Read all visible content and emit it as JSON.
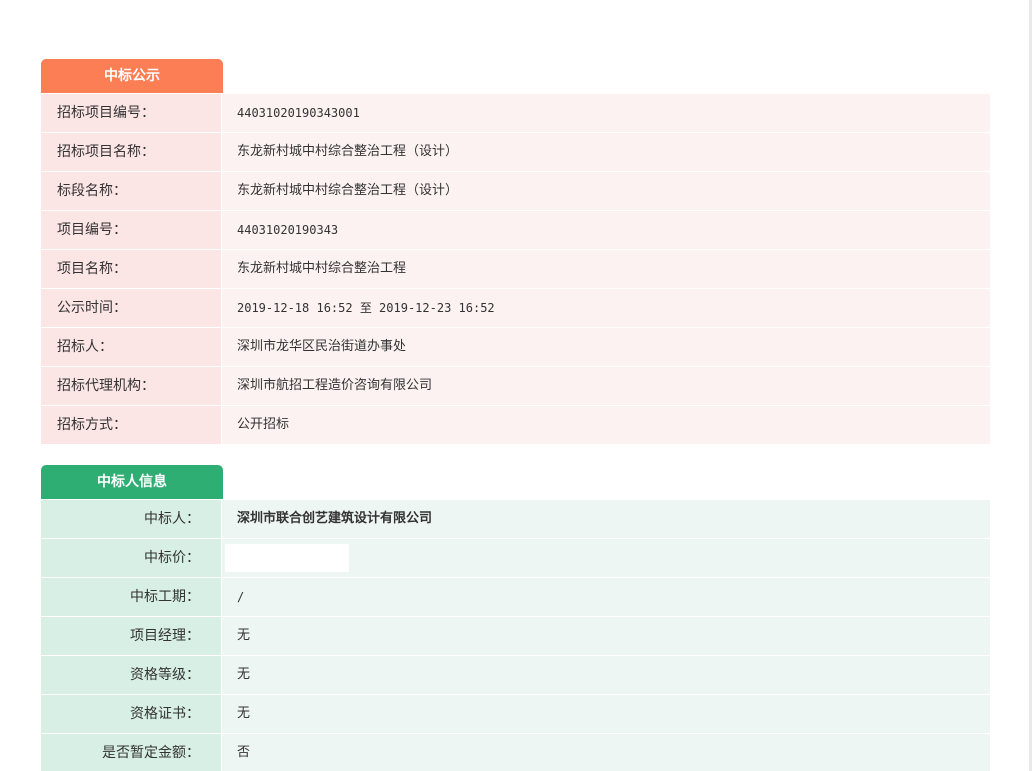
{
  "award_notice": {
    "tab_title": "中标公示",
    "rows": [
      {
        "label": "招标项目编号：",
        "value": "44031020190343001"
      },
      {
        "label": "招标项目名称：",
        "value": "东龙新村城中村综合整治工程（设计）"
      },
      {
        "label": "标段名称：",
        "value": "东龙新村城中村综合整治工程（设计）"
      },
      {
        "label": "项目编号：",
        "value": "44031020190343"
      },
      {
        "label": "项目名称：",
        "value": "东龙新村城中村综合整治工程"
      },
      {
        "label": "公示时间：",
        "value": "2019-12-18 16:52 至 2019-12-23 16:52"
      },
      {
        "label": "招标人：",
        "value": "深圳市龙华区民治街道办事处"
      },
      {
        "label": "招标代理机构：",
        "value": "深圳市航招工程造价咨询有限公司"
      },
      {
        "label": "招标方式：",
        "value": "公开招标"
      }
    ]
  },
  "winner_info": {
    "tab_title": "中标人信息",
    "rows": [
      {
        "label": "中标人：",
        "value": "深圳市联合创艺建筑设计有限公司"
      },
      {
        "label": "中标价：",
        "value": ""
      },
      {
        "label": "中标工期：",
        "value": "/"
      },
      {
        "label": "项目经理：",
        "value": "无"
      },
      {
        "label": "资格等级：",
        "value": "无"
      },
      {
        "label": "资格证书：",
        "value": "无"
      },
      {
        "label": "是否暂定金额：",
        "value": "否"
      }
    ]
  },
  "colors": {
    "orange_tab": "#fb7e55",
    "green_tab": "#2fae74"
  }
}
